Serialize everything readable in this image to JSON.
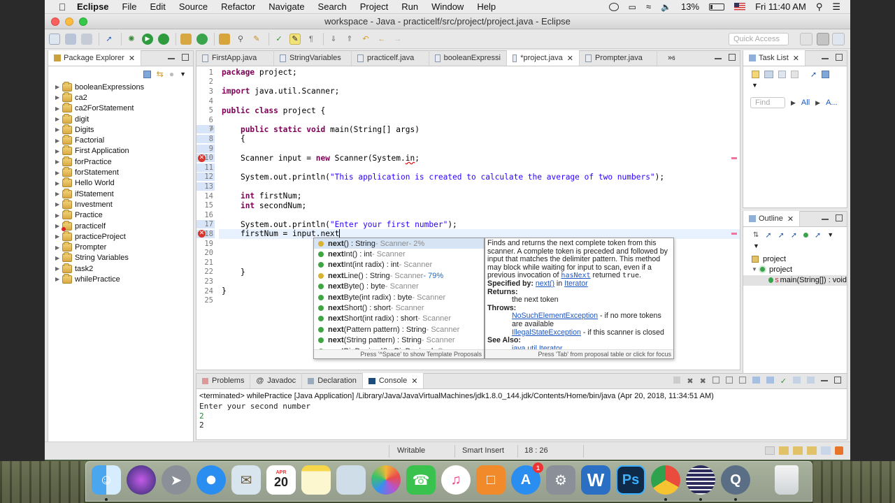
{
  "menubar": {
    "app": "Eclipse",
    "items": [
      "File",
      "Edit",
      "Source",
      "Refactor",
      "Navigate",
      "Search",
      "Project",
      "Run",
      "Window",
      "Help"
    ],
    "battery": "13%",
    "clock": "Fri 11:40 AM"
  },
  "window": {
    "title": "workspace - Java - practicelf/src/project/project.java - Eclipse",
    "quick_access_placeholder": "Quick Access"
  },
  "package_explorer": {
    "title": "Package Explorer",
    "items": [
      "booleanExpressions",
      "ca2",
      "ca2ForStatement",
      "digit",
      "Digits",
      "Factorial",
      "First Application",
      "forPractice",
      "forStatement",
      "Hello World",
      "ifStatement",
      "Investment",
      "Practice",
      "practicelf",
      "practiceProject",
      "Prompter",
      "String Variables",
      "task2",
      "whilePractice"
    ]
  },
  "editor": {
    "tabs": [
      "FirstApp.java",
      "StringVariables",
      "practicelf.java",
      "booleanExpressi",
      "*project.java",
      "Prompter.java"
    ],
    "overflow_count": "6",
    "lines": [
      {
        "n": "1",
        "t": "package project;"
      },
      {
        "n": "2",
        "t": ""
      },
      {
        "n": "3",
        "t": "import java.util.Scanner;"
      },
      {
        "n": "4",
        "t": ""
      },
      {
        "n": "5",
        "t": "public class project {"
      },
      {
        "n": "6",
        "t": ""
      },
      {
        "n": "7",
        "t": "    public static void main(String[] args)"
      },
      {
        "n": "8",
        "t": "    {"
      },
      {
        "n": "9",
        "t": ""
      },
      {
        "n": "10",
        "t": "    Scanner input = new Scanner(System.in;"
      },
      {
        "n": "11",
        "t": ""
      },
      {
        "n": "12",
        "t": "    System.out.println(\"This application is created to calculate the average of two numbers\");"
      },
      {
        "n": "13",
        "t": ""
      },
      {
        "n": "14",
        "t": "    int firstNum;"
      },
      {
        "n": "15",
        "t": "    int secondNum;"
      },
      {
        "n": "16",
        "t": ""
      },
      {
        "n": "17",
        "t": "    System.out.println(\"Enter your first number\");"
      },
      {
        "n": "18",
        "t": "    firstNum = input.next"
      },
      {
        "n": "19",
        "t": ""
      },
      {
        "n": "20",
        "t": ""
      },
      {
        "n": "21",
        "t": ""
      },
      {
        "n": "22",
        "t": "    }"
      },
      {
        "n": "23",
        "t": ""
      },
      {
        "n": "24",
        "t": "}"
      },
      {
        "n": "25",
        "t": ""
      }
    ]
  },
  "content_assist": {
    "proposals": [
      {
        "name": "next",
        "rest": "() : String",
        "type": " - Scanner",
        "pct": " - 2%"
      },
      {
        "name": "next",
        "rest": "Int() : int",
        "type": " - Scanner",
        "pct": ""
      },
      {
        "name": "next",
        "rest": "Int(int radix) : int",
        "type": " - Scanner",
        "pct": ""
      },
      {
        "name": "next",
        "rest": "Line() : String",
        "type": " - Scanner",
        "pct": " - 79%"
      },
      {
        "name": "next",
        "rest": "Byte() : byte",
        "type": " - Scanner",
        "pct": ""
      },
      {
        "name": "next",
        "rest": "Byte(int radix) : byte",
        "type": " - Scanner",
        "pct": ""
      },
      {
        "name": "next",
        "rest": "Short() : short",
        "type": " - Scanner",
        "pct": ""
      },
      {
        "name": "next",
        "rest": "Short(int radix) : short",
        "type": " - Scanner",
        "pct": ""
      },
      {
        "name": "next",
        "rest": "(Pattern pattern) : String",
        "type": " - Scanner",
        "pct": ""
      },
      {
        "name": "next",
        "rest": "(String pattern) : String",
        "type": " - Scanner",
        "pct": ""
      },
      {
        "name": "next",
        "rest": "BigDecimal() : BigDecimal",
        "type": " - Scanner",
        "pct": ""
      }
    ],
    "footer": "Press '^Space' to show Template Proposals"
  },
  "javadoc": {
    "desc1": "Finds and returns the next complete token from this scanner. A complete token is preceded and followed by input that matches the delimiter pattern. This method may block while waiting for input to scan, even if a previous invocation of ",
    "code_hasnext": "hasNext",
    "desc2": " returned ",
    "code_true": "true",
    "desc3": ".",
    "specified_by_label": "Specified by:",
    "specified_by_link": "next()",
    "specified_in": " in ",
    "specified_iface": "Iterator",
    "returns_label": "Returns:",
    "returns_text": "the next token",
    "throws_label": "Throws:",
    "ex1": "NoSuchElementException",
    "ex1_text": " - if no more tokens are available",
    "ex2": "IllegalStateException",
    "ex2_text": " - if this scanner is closed",
    "see_also_label": "See Also:",
    "see_also_link": "java.util.Iterator",
    "footer": "Press 'Tab' from proposal table or click for focus"
  },
  "task_list": {
    "title": "Task List",
    "find_placeholder": "Find",
    "all": "All",
    "activate": "A..."
  },
  "outline": {
    "title": "Outline",
    "items": [
      "project",
      "project",
      "main(String[]) : void"
    ]
  },
  "bottom_panel": {
    "tabs": [
      "Problems",
      "Javadoc",
      "Declaration",
      "Console"
    ],
    "terminated": "<terminated> whilePractice [Java Application] /Library/Java/JavaVirtualMachines/jdk1.8.0_144.jdk/Contents/Home/bin/java (Apr 20, 2018, 11:34:51 AM)",
    "output": [
      "Enter your second number"
    ],
    "input_echo": "2",
    "output2": "2"
  },
  "statusbar": {
    "writable": "Writable",
    "insert_mode": "Smart Insert",
    "position": "18 : 26"
  },
  "dock": {
    "calendar_month": "APR",
    "calendar_day": "20",
    "appstore_badge": "1"
  }
}
